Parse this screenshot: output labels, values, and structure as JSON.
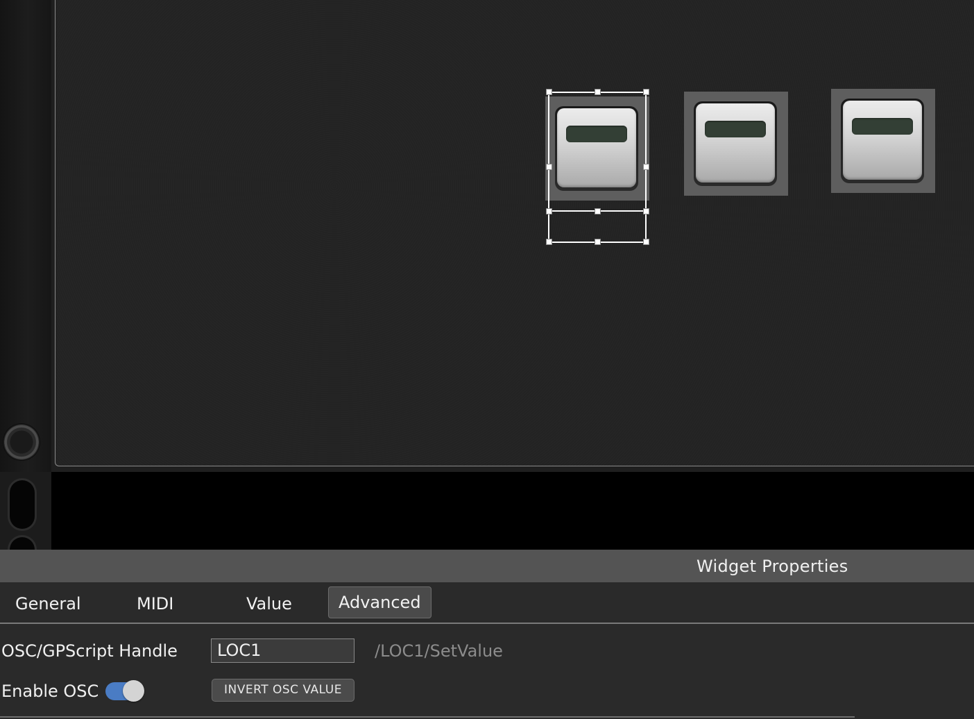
{
  "widgets": [
    {
      "name": "button-widget-1",
      "selected": true
    },
    {
      "name": "button-widget-2",
      "selected": false
    },
    {
      "name": "button-widget-3",
      "selected": false
    }
  ],
  "properties": {
    "title": "Widget Properties",
    "tabs": [
      {
        "label": "General",
        "active": false
      },
      {
        "label": "MIDI",
        "active": false
      },
      {
        "label": "Value",
        "active": false
      },
      {
        "label": "Advanced",
        "active": true
      }
    ],
    "osc_handle_label": "OSC/GPScript Handle",
    "osc_handle_value": "LOC1",
    "osc_path": "/LOC1/SetValue",
    "enable_osc_label": "Enable OSC",
    "enable_osc_on": true,
    "invert_button_label": "INVERT OSC VALUE"
  },
  "colors": {
    "toggle_on": "#4a7cc4",
    "led": "#333f35",
    "panel_bg": "#232323"
  }
}
